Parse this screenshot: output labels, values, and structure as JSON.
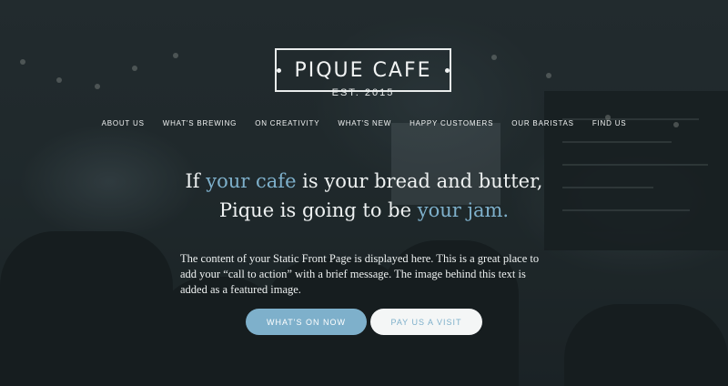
{
  "brand": {
    "name": "PIQUE CAFE",
    "est": "EST. 2015"
  },
  "nav": {
    "items": [
      "ABOUT US",
      "WHAT'S BREWING",
      "ON CREATIVITY",
      "WHAT'S NEW",
      "HAPPY CUSTOMERS",
      "OUR BARISTAS",
      "FIND US"
    ]
  },
  "headline": {
    "line1_a": "If ",
    "line1_highlight": "your cafe",
    "line1_b": " is your bread and butter,",
    "line2_a": "Pique is going to be ",
    "line2_highlight": "your jam."
  },
  "body": {
    "text": "The content of your Static Front Page is displayed here. This is a great place to add your “call to action” with a brief message. The image behind this text is added as a featured image."
  },
  "buttons": {
    "primary": "WHAT'S ON NOW",
    "secondary": "PAY US A VISIT"
  },
  "colors": {
    "accent": "#7eb0cb",
    "text": "#eef1f1"
  }
}
